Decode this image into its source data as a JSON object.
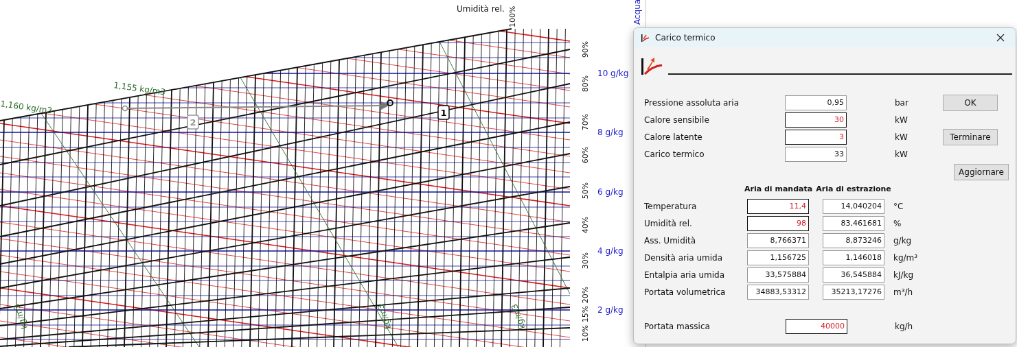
{
  "chart": {
    "title": "Umidità rel.",
    "side_label": "Acqua",
    "rh_labels": [
      "100%",
      "90%",
      "80%",
      "70%",
      "60%",
      "50%",
      "40%",
      "30%",
      "20%",
      "15%",
      "10%"
    ],
    "abs_labels": [
      "10 g/kg",
      "8 g/kg",
      "6 g/kg",
      "4 g/kg",
      "2 g/kg"
    ],
    "density_labels": [
      "1,155 kg/m3",
      "1,160 kg/m3",
      "kg/m3",
      "kg/m3",
      "kg/m3"
    ],
    "markers": [
      "1",
      "2"
    ]
  },
  "dialog": {
    "title": "Carico termico",
    "top_fields": [
      {
        "label": "Pressione assoluta aria",
        "value": "0,95",
        "unit": "bar",
        "editable": false
      },
      {
        "label": "Calore sensibile",
        "value": "30",
        "unit": "kW",
        "editable": true
      },
      {
        "label": "Calore latente",
        "value": "3",
        "unit": "kW",
        "editable": true
      },
      {
        "label": "Carico termico",
        "value": "33",
        "unit": "kW",
        "editable": false
      }
    ],
    "buttons": [
      "OK",
      "Terminare",
      "Aggiornare"
    ],
    "columns": [
      "Aria di mandata",
      "Aria di estrazione"
    ],
    "rows": [
      {
        "label": "Temperatura",
        "supply": {
          "value": "11,4",
          "editable": true
        },
        "exhaust": {
          "value": "14,040204",
          "editable": false
        },
        "unit": "°C"
      },
      {
        "label": "Umidità rel.",
        "supply": {
          "value": "98",
          "editable": true
        },
        "exhaust": {
          "value": "83,461681",
          "editable": false
        },
        "unit": "%"
      },
      {
        "label": "Ass. Umidità",
        "supply": {
          "value": "8,766371",
          "editable": false
        },
        "exhaust": {
          "value": "8,873246",
          "editable": false
        },
        "unit": "g/kg"
      },
      {
        "label": "Densità aria umida",
        "supply": {
          "value": "1,156725",
          "editable": false
        },
        "exhaust": {
          "value": "1,146018",
          "editable": false
        },
        "unit": "kg/m³"
      },
      {
        "label": "Entalpia aria umida",
        "supply": {
          "value": "33,575884",
          "editable": false
        },
        "exhaust": {
          "value": "36,545884",
          "editable": false
        },
        "unit": "kJ/kg"
      },
      {
        "label": "Portata volumetrica",
        "supply": {
          "value": "34883,53312",
          "editable": false
        },
        "exhaust": {
          "value": "35213,17276",
          "editable": false
        },
        "unit": "m³/h"
      }
    ],
    "mass_flow": {
      "label": "Portata massica",
      "value": "40000",
      "unit": "kg/h",
      "editable": true
    }
  }
}
